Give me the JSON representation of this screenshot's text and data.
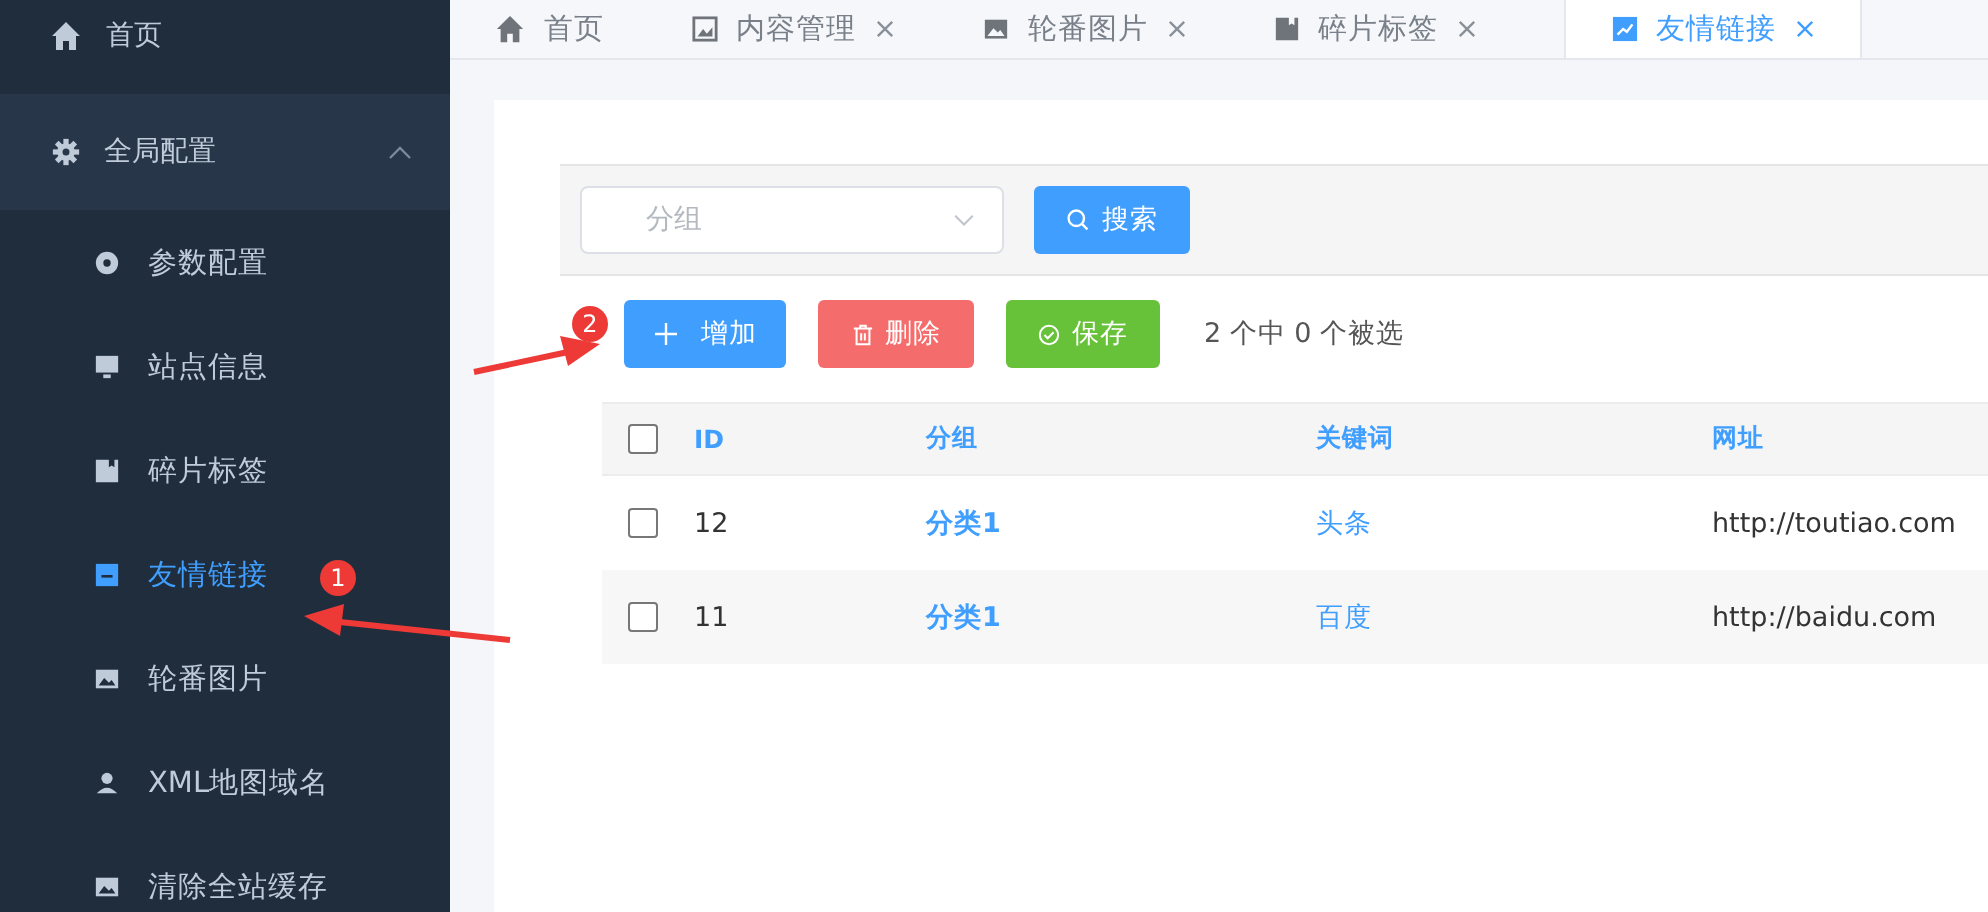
{
  "sidebar": {
    "home": {
      "label": "首页"
    },
    "group": {
      "label": "全局配置",
      "expanded": true,
      "children": [
        {
          "label": "参数配置",
          "selected": false
        },
        {
          "label": "站点信息",
          "selected": false
        },
        {
          "label": "碎片标签",
          "selected": false
        },
        {
          "label": "友情链接",
          "selected": true
        },
        {
          "label": "轮番图片",
          "selected": false
        },
        {
          "label": "XML地图域名",
          "selected": false
        },
        {
          "label": "清除全站缓存",
          "selected": false
        }
      ]
    }
  },
  "tabs": [
    {
      "label": "首页",
      "closable": false,
      "selected": false
    },
    {
      "label": "内容管理",
      "closable": true,
      "selected": false
    },
    {
      "label": "轮番图片",
      "closable": true,
      "selected": false
    },
    {
      "label": "碎片标签",
      "closable": true,
      "selected": false
    },
    {
      "label": "友情链接",
      "closable": true,
      "selected": true
    }
  ],
  "filter": {
    "placeholder": "分组",
    "search_button": "搜索"
  },
  "toolbar": {
    "buttons": [
      {
        "label": "增加",
        "kind": "add"
      },
      {
        "label": "删除",
        "kind": "delete"
      },
      {
        "label": "保存",
        "kind": "save"
      }
    ],
    "selection_info": "2 个中 0 个被选"
  },
  "table": {
    "all_selected": false,
    "columns": [
      "ID",
      "分组",
      "关键词",
      "网址"
    ],
    "rows": [
      {
        "selected": false,
        "cells": [
          "12",
          "分类1",
          "头条",
          "http://toutiao.com"
        ]
      },
      {
        "selected": false,
        "cells": [
          "11",
          "分类1",
          "百度",
          "http://baidu.com"
        ]
      }
    ]
  },
  "annotations": [
    {
      "label": "1"
    },
    {
      "label": "2"
    }
  ]
}
